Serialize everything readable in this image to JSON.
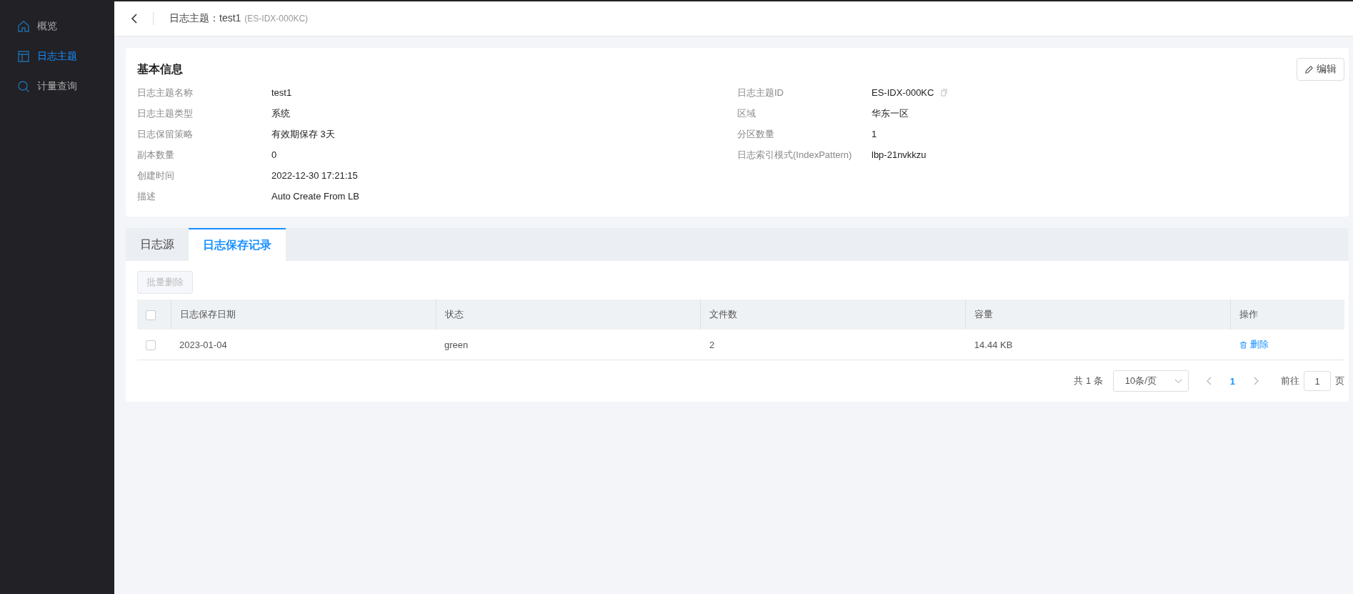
{
  "sidebar": {
    "items": [
      {
        "label": "概览",
        "kind": "home",
        "selected": false
      },
      {
        "label": "日志主题",
        "kind": "layout",
        "selected": true
      },
      {
        "label": "计量查询",
        "kind": "search",
        "selected": false
      }
    ]
  },
  "header": {
    "title": "日志主题：test1",
    "subtitle": "(ES-IDX-000KC)"
  },
  "info": {
    "title": "基本信息",
    "edit_button": "编辑",
    "left": [
      {
        "label": "日志主题名称",
        "value": "test1",
        "copyable": false
      },
      {
        "label": "日志主题类型",
        "value": "系统",
        "copyable": false
      },
      {
        "label": "日志保留策略",
        "value": "有效期保存 3天",
        "copyable": false
      },
      {
        "label": "副本数量",
        "value": "0",
        "copyable": false
      },
      {
        "label": "创建时间",
        "value": "2022-12-30 17:21:15",
        "copyable": false
      },
      {
        "label": "描述",
        "value": "Auto Create From LB",
        "copyable": false
      }
    ],
    "right": [
      {
        "label": "日志主题ID",
        "value": "ES-IDX-000KC",
        "copyable": true
      },
      {
        "label": "区域",
        "value": "华东一区",
        "copyable": false
      },
      {
        "label": "分区数量",
        "value": "1",
        "copyable": false
      },
      {
        "label": "日志索引模式(IndexPattern)",
        "value": "lbp-21nvkkzu",
        "copyable": false
      }
    ]
  },
  "tabs": [
    {
      "label": "日志源",
      "selected": false
    },
    {
      "label": "日志保存记录",
      "selected": true
    }
  ],
  "batch_delete": {
    "label": "批量删除",
    "disabled": true
  },
  "table": {
    "header_checked": false,
    "columns": [
      "日志保存日期",
      "状态",
      "文件数",
      "容量",
      "操作"
    ],
    "rows": [
      {
        "checked": false,
        "cells": [
          "2023-01-04",
          "green",
          "2",
          "14.44 KB"
        ],
        "action": "删除"
      }
    ]
  },
  "pagination": {
    "total": "共 1 条",
    "page_size": "10条/页",
    "pages": [
      {
        "label": "1",
        "selected": true
      }
    ],
    "goto_label": "前往",
    "goto_value": "1",
    "page_suffix": "页"
  }
}
